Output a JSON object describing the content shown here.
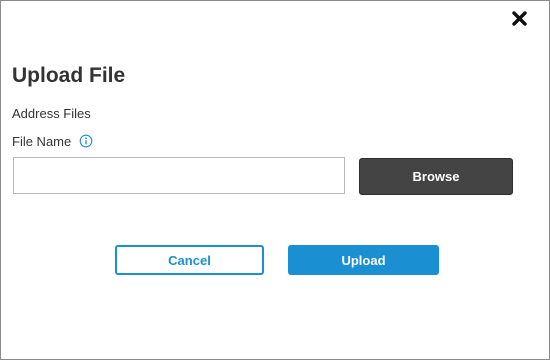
{
  "dialog": {
    "title": "Upload File",
    "close_icon": "close-x-icon",
    "section_label": "Address Files",
    "file_name": {
      "label": "File Name",
      "info_icon": "info-circle-icon",
      "value": "",
      "placeholder": ""
    },
    "browse_label": "Browse",
    "cancel_label": "Cancel",
    "upload_label": "Upload"
  },
  "colors": {
    "accent": "#1a8fd2",
    "browse_background": "#444444",
    "text": "#333333",
    "border": "#8a8a8a"
  }
}
